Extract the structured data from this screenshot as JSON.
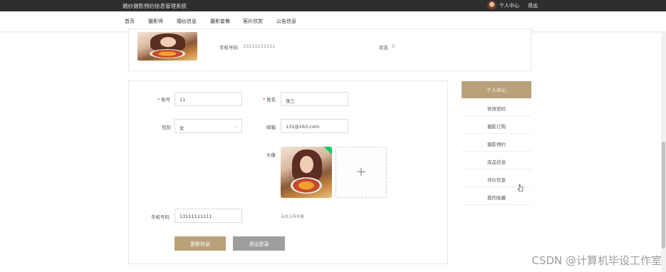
{
  "app": {
    "title": "婚纱摄影预约信息管理系统",
    "user_center_link": "个人中心",
    "logout_link": "退出"
  },
  "nav": {
    "items": [
      {
        "label": "首页"
      },
      {
        "label": "摄影师"
      },
      {
        "label": "婚纱信息"
      },
      {
        "label": "摄影套餐"
      },
      {
        "label": "客片欣赏"
      },
      {
        "label": "公告信息"
      }
    ]
  },
  "profile_summary": {
    "phone_label": "手机号码",
    "phone_value": "13111111111",
    "status_label": "状态",
    "status_value": "0"
  },
  "form": {
    "account_label": "账号",
    "account_value": "11",
    "name_label": "姓名",
    "name_value": "张三",
    "gender_label": "性别",
    "gender_value": "女",
    "email_label": "邮箱",
    "email_value": "131@163.com",
    "avatar_label": "头像",
    "avatar_hint": "点击上传头像",
    "phone_label": "手机号码",
    "phone_value": "13111111111",
    "update_button": "更新信息",
    "logout_button": "退出登录"
  },
  "side_menu": {
    "title": "个人中心",
    "items": [
      {
        "label": "修改密码"
      },
      {
        "label": "摄影订购"
      },
      {
        "label": "摄影预约"
      },
      {
        "label": "成品信息"
      },
      {
        "label": "评价信息"
      },
      {
        "label": "我的收藏"
      }
    ]
  },
  "watermark": "CSDN @计算机毕设工作室",
  "colors": {
    "topbar": "#2e2e2e",
    "accent": "#b9a17a",
    "secondary_button": "#9e9e9e",
    "required": "#e0443b",
    "upload_check": "#13ce66"
  },
  "icons": [
    "user-avatar-icon",
    "chevron-down-icon",
    "plus-icon",
    "check-corner-icon",
    "mouse-pointer-icon"
  ]
}
